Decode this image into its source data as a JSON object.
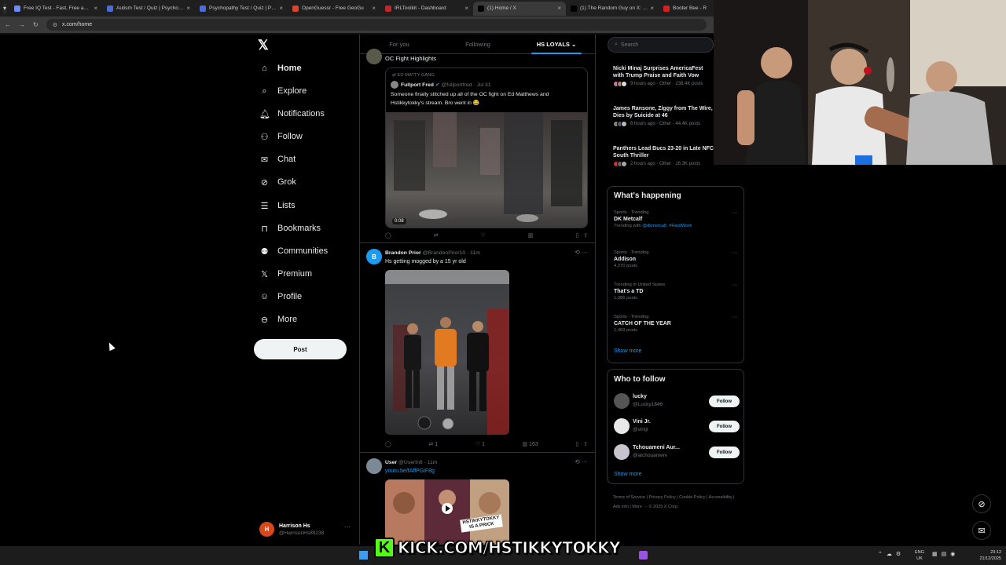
{
  "browser": {
    "tabs": [
      {
        "title": "Free IQ Test - Fast, Free and Ac",
        "color": "#6b8cff"
      },
      {
        "title": "Autism Test / Quiz | Psycholog",
        "color": "#4f6bd8"
      },
      {
        "title": "Psychopathy Test / Quiz | Psych",
        "color": "#4f6bd8"
      },
      {
        "title": "OpenGuessr - Free GeoGu",
        "color": "#e0412b"
      },
      {
        "title": "IRLToolkit - Dashboard",
        "color": "#c2262b"
      },
      {
        "title": "(1) Home / X",
        "color": "#000000"
      },
      {
        "title": "(1) The Random Guy on X: \"@Y",
        "color": "#000000"
      },
      {
        "title": "Booter Bee - R",
        "color": "#d6201f"
      }
    ],
    "active_tab_index": 5,
    "url": "x.com/home"
  },
  "nav": {
    "items": [
      {
        "label": "Home",
        "icon": "home-icon"
      },
      {
        "label": "Explore",
        "icon": "search-icon"
      },
      {
        "label": "Notifications",
        "icon": "bell-icon"
      },
      {
        "label": "Follow",
        "icon": "person-plus-icon"
      },
      {
        "label": "Chat",
        "icon": "mail-icon"
      },
      {
        "label": "Grok",
        "icon": "grok-icon"
      },
      {
        "label": "Lists",
        "icon": "list-icon"
      },
      {
        "label": "Bookmarks",
        "icon": "bookmark-icon"
      },
      {
        "label": "Communities",
        "icon": "people-icon"
      },
      {
        "label": "Premium",
        "icon": "x-icon"
      },
      {
        "label": "Profile",
        "icon": "person-icon"
      },
      {
        "label": "More",
        "icon": "more-circle-icon"
      }
    ],
    "post_label": "Post",
    "account": {
      "name": "Harrison Hs",
      "handle": "@HarrisonHs89238",
      "initial": "H",
      "dots": "···"
    }
  },
  "timeline": {
    "tabs": [
      "For you",
      "Following",
      "HS LOYALS"
    ],
    "tweet1": {
      "text": "OC Fight Highlights",
      "quote_label": "ED MATTY GANG",
      "quote_name": "Fullport Fred",
      "quote_handle": "@fullportfred · Jul 31",
      "quote_text_1": "Someone finally stitched up all of the OC fight on Ed Matthews and",
      "quote_text_2": "Hstikkytokky's stream. Bro went in 😂",
      "duration": "0:08"
    },
    "tweet2": {
      "initial": "B",
      "name": "Brandon Prior",
      "handle": "@BrandonPrior10 · 11m",
      "text": "Hs getting mogged by a 15 yr old",
      "retweets": "1",
      "likes": "1",
      "views": "163"
    },
    "tweet3": {
      "name": "User",
      "handle": "@Usertn6 · 11m",
      "link": "youtu.be/fAffPGiF8g",
      "thumb_text_1": "HSTIKKYTOKKY",
      "thumb_text_2": "IS A PRICK"
    }
  },
  "sidebar": {
    "search_placeholder": "Search",
    "news": [
      {
        "headline": "Nicki Minaj Surprises AmericaFest with Trump Praise and Faith Vow",
        "meta": "9 hours ago · Other · 238.4K posts"
      },
      {
        "headline": "James Ransone, Ziggy from The Wire, Dies by Suicide at 46",
        "meta": "6 hours ago · Other · 44.4K posts"
      },
      {
        "headline": "Panthers Lead Bucs 23-20 in Late NFC South Thriller",
        "meta": "2 hours ago · Other · 16.3K posts"
      }
    ],
    "happening_title": "What's happening",
    "trends": [
      {
        "context": "Sports · Trending",
        "name": "DK Metcalf",
        "posts": "Trending with ",
        "links": "@dkmetcalf, #HardWork",
        "more": "···"
      },
      {
        "context": "Sports · Trending",
        "name": "Addison",
        "posts": "4,270 posts",
        "more": "···"
      },
      {
        "context": "Trending in United States",
        "name": "That's a TD",
        "posts": "1,386 posts",
        "more": "···"
      },
      {
        "context": "Sports · Trending",
        "name": "CATCH OF THE YEAR",
        "posts": "1,469 posts",
        "more": "···"
      }
    ],
    "show_more": "Show more",
    "who_title": "Who to follow",
    "follow": [
      {
        "name": "lucky",
        "handle": "@Lucky1846",
        "button": "Follow"
      },
      {
        "name": "Vini Jr.",
        "handle": "@vinijr",
        "button": "Follow"
      },
      {
        "name": "Tchouameni Aur...",
        "handle": "@atchouameni",
        "button": "Follow"
      }
    ],
    "follow_show_more": "Show more",
    "footer": "Terms of Service  |  Privacy Policy  |  Cookie Policy  |  Accessibility  |  Ads info  |  More ···  © 2025 X Corp."
  },
  "overlay": {
    "kick_logo": "K",
    "kick_url": "KICK.COM/HSTIKKYTOKKY"
  },
  "taskbar": {
    "lang_1": "ENG",
    "lang_2": "UK",
    "time": "23:12",
    "date": "21/12/2025"
  }
}
